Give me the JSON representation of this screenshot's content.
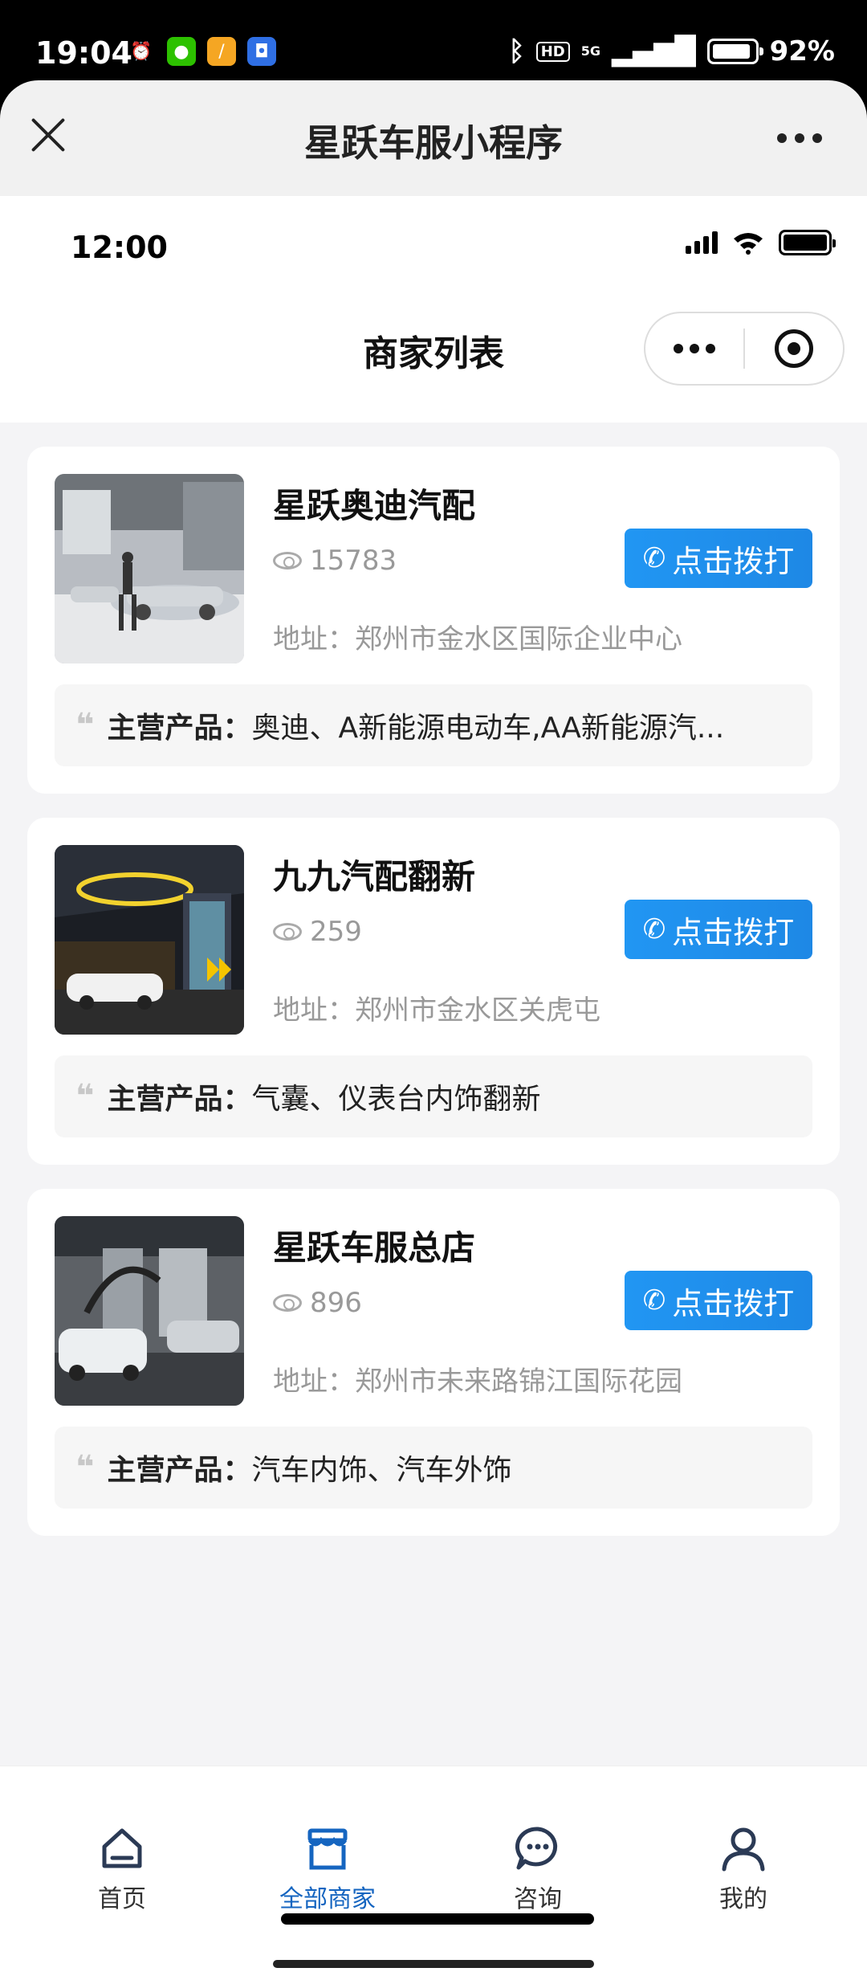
{
  "system_status": {
    "time": "19:04",
    "network": "5G",
    "hd": "HD",
    "battery": "92%"
  },
  "miniprogram": {
    "title": "星跃车服小程序"
  },
  "app_status": {
    "time": "12:00"
  },
  "page": {
    "title": "商家列表"
  },
  "merchants": [
    {
      "name": "星跃奥迪汽配",
      "views": "15783",
      "call_label": "点击拨打",
      "address_label": "地址：",
      "address": "郑州市金水区国际企业中心",
      "products_label": "主营产品：",
      "products": "奥迪、A新能源电动车,AA新能源汽..."
    },
    {
      "name": "九九汽配翻新",
      "views": "259",
      "call_label": "点击拨打",
      "address_label": "地址：",
      "address": "郑州市金水区关虎屯",
      "products_label": "主营产品：",
      "products": "气囊、仪表台内饰翻新"
    },
    {
      "name": "星跃车服总店",
      "views": "896",
      "call_label": "点击拨打",
      "address_label": "地址：",
      "address": "郑州市未来路锦江国际花园",
      "products_label": "主营产品：",
      "products": "汽车内饰、汽车外饰"
    }
  ],
  "tabbar": {
    "items": [
      {
        "label": "首页",
        "icon": "home-icon",
        "active": false
      },
      {
        "label": "全部商家",
        "icon": "store-icon",
        "active": true
      },
      {
        "label": "咨询",
        "icon": "chat-icon",
        "active": false
      },
      {
        "label": "我的",
        "icon": "user-icon",
        "active": false
      }
    ]
  },
  "colors": {
    "accent": "#1e88e5",
    "active_tab": "#1565c0",
    "background": "#f4f4f6"
  }
}
